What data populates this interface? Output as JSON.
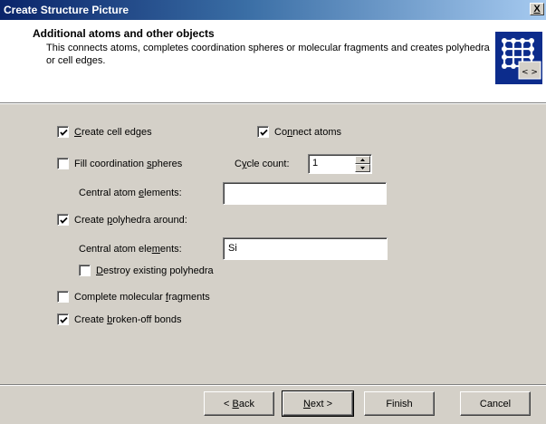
{
  "window": {
    "title": "Create Structure Picture",
    "close_label": "X"
  },
  "header": {
    "title": "Additional atoms and other objects",
    "description": "This connects atoms, completes coordination spheres or molecular fragments and creates polyhedra or cell edges.",
    "icon": "grid-structure-icon"
  },
  "options": {
    "create_cell_edges": {
      "pre": "",
      "key": "C",
      "post": "reate cell edges",
      "checked": true
    },
    "connect_atoms": {
      "pre": "Co",
      "key": "n",
      "post": "nect atoms",
      "checked": true
    },
    "fill_coordination": {
      "pre": "Fill coordination ",
      "key": "s",
      "post": "pheres",
      "checked": false
    },
    "cycle_count": {
      "pre": "C",
      "key": "y",
      "post": "cle count:",
      "value": "1"
    },
    "central_atom_elements_1": {
      "pre": "Central atom ",
      "key": "e",
      "post": "lements:",
      "value": ""
    },
    "create_polyhedra": {
      "pre": "Create ",
      "key": "p",
      "post": "olyhedra around:",
      "checked": true
    },
    "central_atom_elements_2": {
      "pre": "Central atom ele",
      "key": "m",
      "post": "ents:",
      "value": "Si"
    },
    "destroy_polyhedra": {
      "pre": "",
      "key": "D",
      "post": "estroy existing polyhedra",
      "checked": false
    },
    "complete_fragments": {
      "pre": "Complete molecular ",
      "key": "f",
      "post": "ragments",
      "checked": false
    },
    "create_broken_bonds": {
      "pre": "Create ",
      "key": "b",
      "post": "roken-off bonds",
      "checked": true
    }
  },
  "buttons": {
    "back": {
      "pre": "< ",
      "key": "B",
      "post": "ack"
    },
    "next": {
      "pre": "",
      "key": "N",
      "post": "ext >"
    },
    "finish": "Finish",
    "cancel": "Cancel"
  }
}
